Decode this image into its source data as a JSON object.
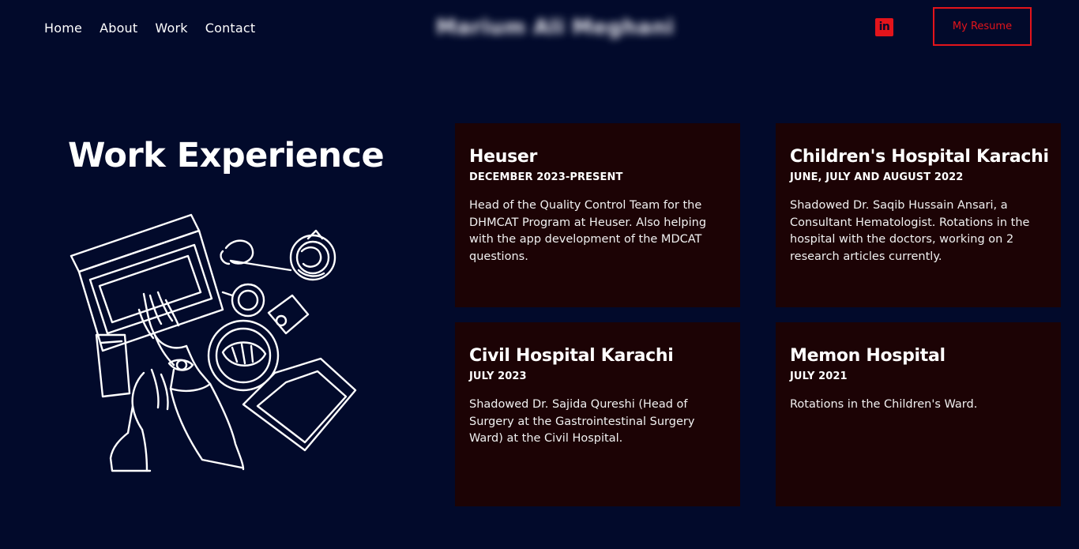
{
  "nav": {
    "links": [
      "Home",
      "About",
      "Work",
      "Contact"
    ],
    "brand": "Marium Ali Meghani",
    "linkedin_icon": "linkedin-icon",
    "resume_label": "My Resume"
  },
  "section": {
    "title": "Work Experience",
    "illustration": "workspace-line-art"
  },
  "cards": [
    {
      "title": "Heuser",
      "date": "DECEMBER 2023-PRESENT",
      "description": "Head of the Quality Control Team for the DHMCAT Program at Heuser. Also helping with the app development of the MDCAT questions."
    },
    {
      "title": "Children's Hospital Karachi",
      "date": "JUNE, JULY AND AUGUST 2022",
      "description": "Shadowed Dr. Saqib Hussain Ansari, a Consultant Hematologist. Rotations in the hospital with the doctors, working on 2 research articles currently."
    },
    {
      "title": "Civil Hospital Karachi",
      "date": "JULY 2023",
      "description": "Shadowed Dr. Sajida Qureshi (Head of Surgery at the Gastrointestinal Surgery Ward) at the Civil Hospital."
    },
    {
      "title": "Memon Hospital",
      "date": "JULY 2021",
      "description": "Rotations in the Children's Ward."
    }
  ],
  "colors": {
    "background": "#020a2b",
    "card": "#1c0305",
    "accent": "#e3141b"
  }
}
